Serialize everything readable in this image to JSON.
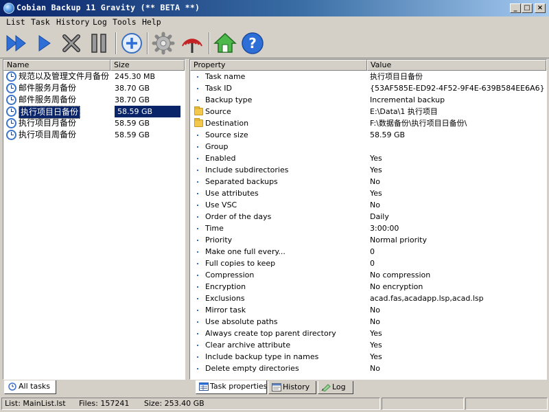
{
  "window": {
    "title": "Cobian Backup 11 Gravity (** BETA **)"
  },
  "menu": [
    "List",
    "Task",
    "History",
    "Log",
    "Tools",
    "Help"
  ],
  "toolbar": [
    {
      "name": "run-all-tasks-button",
      "icon": "double-play-icon"
    },
    {
      "name": "run-selected-task-button",
      "icon": "play-icon"
    },
    {
      "name": "cancel-button",
      "icon": "x-icon"
    },
    {
      "name": "pause-button",
      "icon": "pause-icon"
    },
    {
      "name": "add-task-button",
      "icon": "plus-circle-icon"
    },
    {
      "name": "settings-button",
      "icon": "gear-icon"
    },
    {
      "name": "remote-button",
      "icon": "antenna-icon"
    },
    {
      "name": "home-button",
      "icon": "home-icon"
    },
    {
      "name": "help-button",
      "icon": "help-icon"
    }
  ],
  "task_list": {
    "headers": {
      "name": "Name",
      "size": "Size"
    },
    "rows": [
      {
        "name": "规范以及管理文件月备份",
        "size": "245.30 MB"
      },
      {
        "name": "邮件服务月备份",
        "size": "38.70 GB"
      },
      {
        "name": "邮件服务周备份",
        "size": "38.70 GB"
      },
      {
        "name": "执行项目日备份",
        "size": "58.59 GB",
        "selected": true
      },
      {
        "name": "执行项目月备份",
        "size": "58.59 GB"
      },
      {
        "name": "执行项目周备份",
        "size": "58.59 GB"
      }
    ],
    "tab": "All tasks"
  },
  "properties": {
    "headers": {
      "property": "Property",
      "value": "Value"
    },
    "rows": [
      {
        "name": "Task name",
        "value": "执行项目日备份"
      },
      {
        "name": "Task ID",
        "value": "{53AF585E-ED92-4F52-9F4E-639B584EE6A6}"
      },
      {
        "name": "Backup type",
        "value": "Incremental backup"
      },
      {
        "name": "Source",
        "value": "E:\\Data\\1 执行项目",
        "folder": true
      },
      {
        "name": "Destination",
        "value": "F:\\数据备份\\执行项目日备份\\",
        "folder": true
      },
      {
        "name": "Source size",
        "value": "58.59 GB"
      },
      {
        "name": "Group",
        "value": ""
      },
      {
        "name": "Enabled",
        "value": "Yes"
      },
      {
        "name": "Include subdirectories",
        "value": "Yes"
      },
      {
        "name": "Separated backups",
        "value": "No"
      },
      {
        "name": "Use attributes",
        "value": "Yes"
      },
      {
        "name": "Use VSC",
        "value": "No"
      },
      {
        "name": "Order of the days",
        "value": "Daily"
      },
      {
        "name": "Time",
        "value": "3:00:00"
      },
      {
        "name": "Priority",
        "value": "Normal priority"
      },
      {
        "name": "Make one full every...",
        "value": "0"
      },
      {
        "name": "Full copies to keep",
        "value": "0"
      },
      {
        "name": "Compression",
        "value": "No compression"
      },
      {
        "name": "Encryption",
        "value": "No encryption"
      },
      {
        "name": "Exclusions",
        "value": "acad.fas,acadapp.lsp,acad.lsp"
      },
      {
        "name": "Mirror task",
        "value": "No"
      },
      {
        "name": "Use absolute paths",
        "value": "No"
      },
      {
        "name": "Always create top parent directory",
        "value": "Yes"
      },
      {
        "name": "Clear archive attribute",
        "value": "Yes"
      },
      {
        "name": "Include backup type in names",
        "value": "Yes"
      },
      {
        "name": "Delete empty directories",
        "value": "No"
      }
    ],
    "tabs": [
      "Task properties",
      "History",
      "Log"
    ]
  },
  "status": {
    "list": "List: MainList.lst",
    "files": "Files: 157241",
    "size": "Size: 253.40 GB"
  }
}
